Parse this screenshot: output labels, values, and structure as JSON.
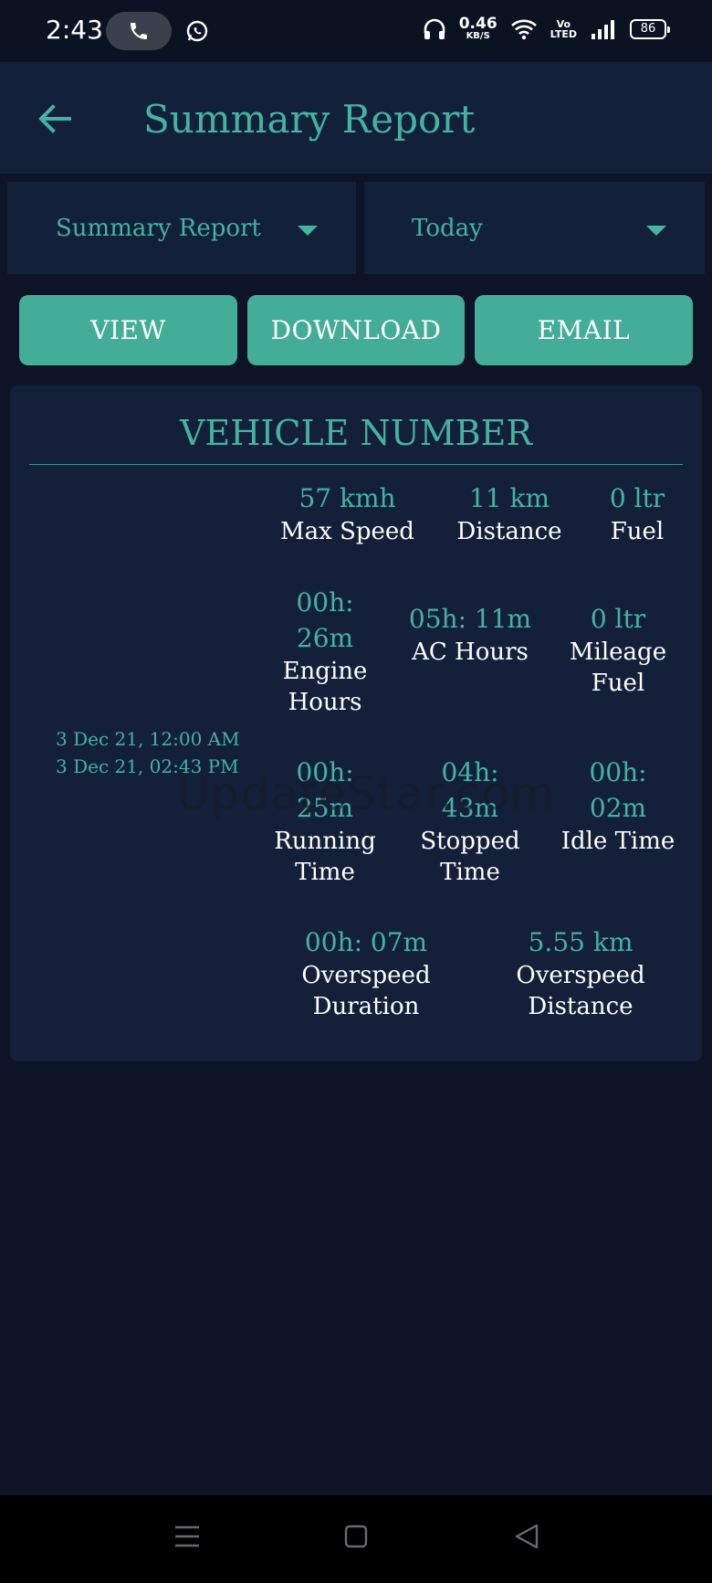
{
  "status_bar": {
    "time": "2:43",
    "net_speed_value": "0.46",
    "net_speed_unit": "KB/S",
    "volte_top": "Vo",
    "volte_bottom": "LTED",
    "battery": "86"
  },
  "app_bar": {
    "title": "Summary Report"
  },
  "filters": {
    "report_type": "Summary Report",
    "date_range": "Today"
  },
  "actions": {
    "view": "VIEW",
    "download": "DOWNLOAD",
    "email": "EMAIL"
  },
  "summary": {
    "heading": "VEHICLE NUMBER",
    "date_from": "3 Dec 21, 12:00 AM",
    "date_to": "3 Dec 21, 02:43 PM",
    "metrics": {
      "max_speed": {
        "value": "57 kmh",
        "label": "Max Speed"
      },
      "distance": {
        "value": "11 km",
        "label": "Distance"
      },
      "fuel": {
        "value": "0 ltr",
        "label": "Fuel"
      },
      "engine_hours": {
        "value_line1": "00h:",
        "value_line2": "26m",
        "label_line1": "Engine",
        "label_line2": "Hours"
      },
      "ac_hours": {
        "value": "05h: 11m",
        "label": "AC Hours"
      },
      "mileage_fuel": {
        "value": "0 ltr",
        "label_line1": "Mileage",
        "label_line2": "Fuel"
      },
      "running_time": {
        "value_line1": "00h:",
        "value_line2": "25m",
        "label_line1": "Running",
        "label_line2": "Time"
      },
      "stopped_time": {
        "value_line1": "04h:",
        "value_line2": "43m",
        "label_line1": "Stopped",
        "label_line2": "Time"
      },
      "idle_time": {
        "value_line1": "00h:",
        "value_line2": "02m",
        "label": "Idle Time"
      },
      "overspeed_duration": {
        "value": "00h: 07m",
        "label_line1": "Overspeed",
        "label_line2": "Duration"
      },
      "overspeed_distance": {
        "value": "5.55 km",
        "label_line1": "Overspeed",
        "label_line2": "Distance"
      }
    }
  },
  "watermark": "UpdateStar.com",
  "colors": {
    "accent": "#44b3a2",
    "button": "#44ad98",
    "surface": "#13203a",
    "background": "#0c1425"
  }
}
